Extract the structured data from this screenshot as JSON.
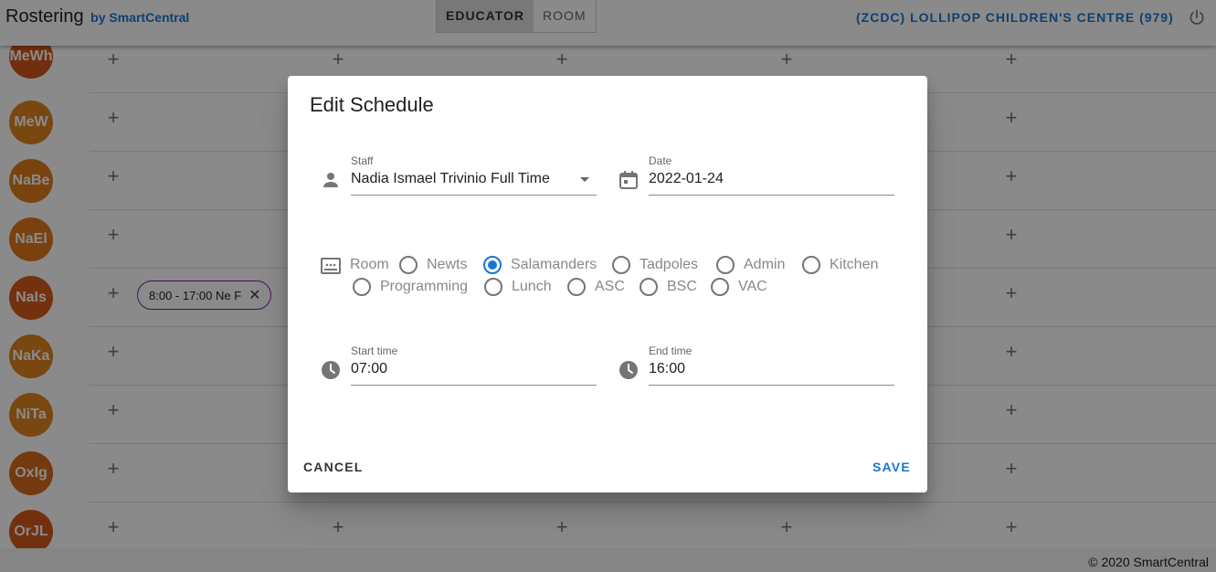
{
  "app": {
    "title": "Rostering",
    "by": "by SmartCentral",
    "view_toggle": [
      "EDUCATOR",
      "ROOM"
    ],
    "active_view": "EDUCATOR",
    "centre": "(ZCDC) LOLLIPOP CHILDREN'S CENTRE (979)",
    "power_icon": "power-icon"
  },
  "roster": {
    "rows": [
      {
        "initials": "MeWh",
        "color": "#d2581a"
      },
      {
        "initials": "MeW",
        "color": "#e0861e"
      },
      {
        "initials": "NaBe",
        "color": "#e07d1d"
      },
      {
        "initials": "NaEl",
        "color": "#e0791c"
      },
      {
        "initials": "NaIs",
        "color": "#d75b19"
      },
      {
        "initials": "NaKa",
        "color": "#e0861e"
      },
      {
        "initials": "NiTa",
        "color": "#e0861e"
      },
      {
        "initials": "OxIg",
        "color": "#d9691c"
      },
      {
        "initials": "OrJL",
        "color": "#d45a1a"
      }
    ],
    "shift_chip": "8:00 - 17:00 Ne F"
  },
  "footer": "© 2020 SmartCentral",
  "dialog": {
    "title": "Edit Schedule",
    "staff_label": "Staff",
    "staff_value": "Nadia Ismael Trivinio Full Time",
    "date_label": "Date",
    "date_value": "2022-01-24",
    "room_label": "Room",
    "rooms": [
      "Newts",
      "Salamanders",
      "Tadpoles",
      "Admin",
      "Kitchen",
      "Programming",
      "Lunch",
      "ASC",
      "BSC",
      "VAC"
    ],
    "selected_room": "Salamanders",
    "start_label": "Start time",
    "start_value": "07:00",
    "end_label": "End time",
    "end_value": "16:00",
    "cancel": "CANCEL",
    "save": "SAVE"
  },
  "colors": {
    "accent": "#1976d2",
    "chip_border": "#7b1fa2"
  }
}
